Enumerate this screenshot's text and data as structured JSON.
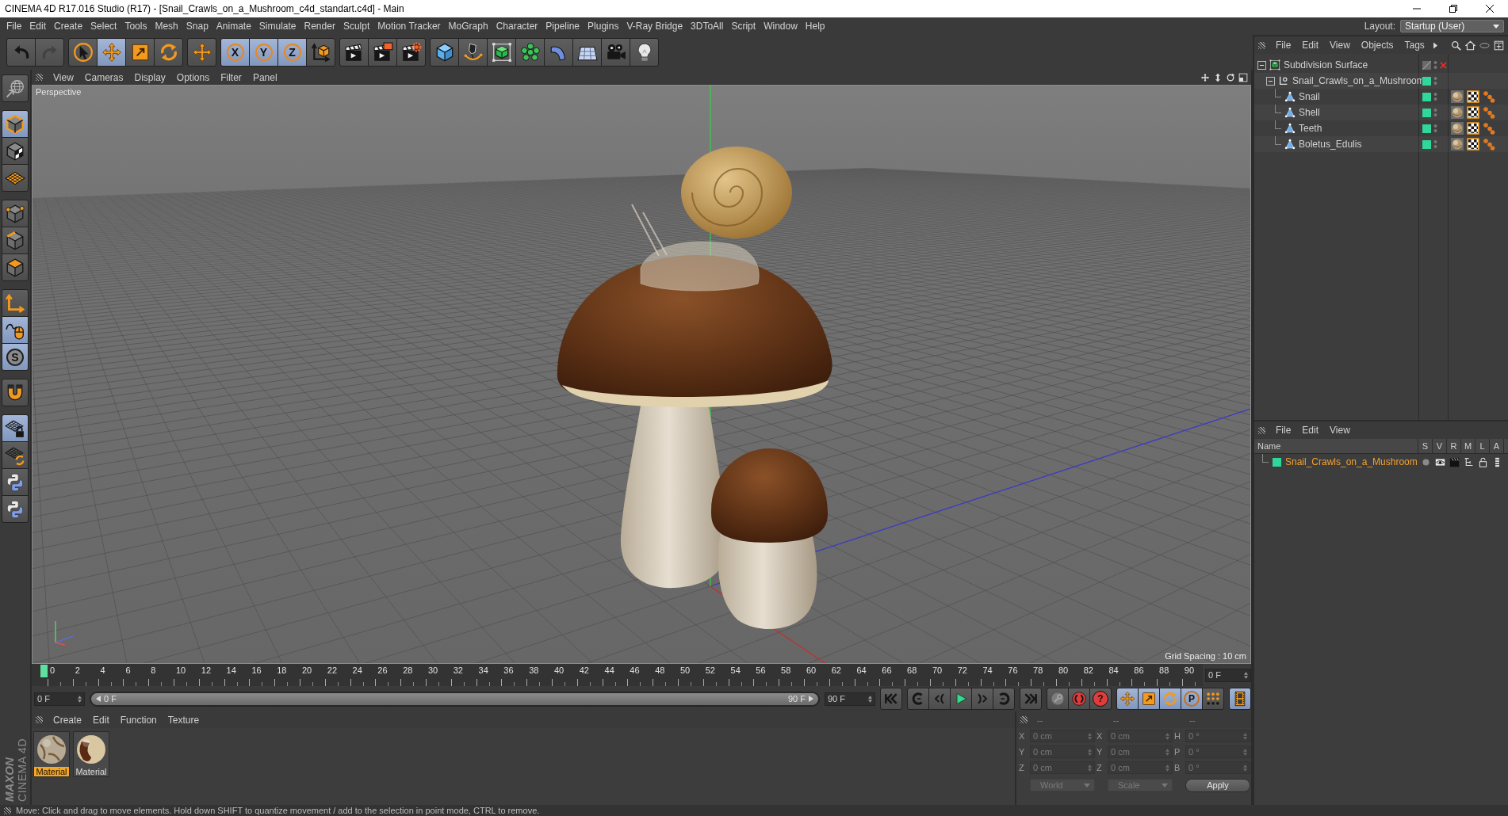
{
  "window": {
    "title": "CINEMA 4D R17.016 Studio (R17) - [Snail_Crawls_on_a_Mushroom_c4d_standart.c4d] - Main"
  },
  "menu_bar": [
    "File",
    "Edit",
    "Create",
    "Select",
    "Tools",
    "Mesh",
    "Snap",
    "Animate",
    "Simulate",
    "Render",
    "Sculpt",
    "Motion Tracker",
    "MoGraph",
    "Character",
    "Pipeline",
    "Plugins",
    "V-Ray Bridge",
    "3DToAll",
    "Script",
    "Window",
    "Help"
  ],
  "layout": {
    "label": "Layout:",
    "value": "Startup (User)"
  },
  "toolbar": [
    [
      {
        "kind": "undo",
        "selected": false,
        "disabled": false
      },
      {
        "kind": "redo",
        "selected": false,
        "disabled": true
      }
    ],
    [
      {
        "kind": "live-selection",
        "selected": false,
        "disabled": false
      },
      {
        "kind": "move",
        "selected": true,
        "disabled": false
      },
      {
        "kind": "scale",
        "selected": false,
        "disabled": false
      },
      {
        "kind": "rotate",
        "selected": false,
        "disabled": false
      }
    ],
    [
      {
        "kind": "recent-tool",
        "selected": false,
        "disabled": false
      }
    ],
    [
      {
        "kind": "x-axis",
        "label": "X",
        "selected": true,
        "disabled": false
      },
      {
        "kind": "y-axis",
        "label": "Y",
        "selected": true,
        "disabled": false
      },
      {
        "kind": "z-axis",
        "label": "Z",
        "selected": true,
        "disabled": false
      },
      {
        "kind": "coordinate-system",
        "selected": false,
        "disabled": false
      }
    ],
    [
      {
        "kind": "render-view",
        "selected": false,
        "disabled": false
      },
      {
        "kind": "render-picture-viewer",
        "selected": false,
        "disabled": false
      },
      {
        "kind": "render-settings",
        "selected": false,
        "disabled": false
      }
    ],
    [
      {
        "kind": "cube",
        "selected": false,
        "disabled": false
      },
      {
        "kind": "pen",
        "selected": false,
        "disabled": false
      },
      {
        "kind": "subdivision",
        "selected": false,
        "disabled": false
      },
      {
        "kind": "cloner",
        "selected": false,
        "disabled": false
      },
      {
        "kind": "bend",
        "selected": false,
        "disabled": false
      },
      {
        "kind": "floor",
        "selected": false,
        "disabled": false
      },
      {
        "kind": "camera",
        "selected": false,
        "disabled": false
      },
      {
        "kind": "light",
        "selected": false,
        "disabled": false
      }
    ]
  ],
  "tools": [
    [
      {
        "kind": "make-editable",
        "selected": false
      }
    ],
    [
      {
        "kind": "model",
        "selected": true
      },
      {
        "kind": "texture",
        "selected": false
      },
      {
        "kind": "workplane",
        "selected": false
      }
    ],
    [
      {
        "kind": "points",
        "selected": false
      },
      {
        "kind": "edges",
        "selected": false
      },
      {
        "kind": "polygons",
        "selected": false
      }
    ],
    [
      {
        "kind": "axis",
        "selected": false
      },
      {
        "kind": "tweak",
        "selected": true
      },
      {
        "kind": "solo",
        "label": "S",
        "selected": true
      }
    ],
    [
      {
        "kind": "snap",
        "selected": false
      }
    ],
    [
      {
        "kind": "workplane-lock",
        "selected": true
      },
      {
        "kind": "workplane-align",
        "selected": false
      },
      {
        "kind": "python",
        "selected": false
      },
      {
        "kind": "python",
        "selected": false
      }
    ]
  ],
  "viewport": {
    "menu": [
      "View",
      "Cameras",
      "Display",
      "Options",
      "Filter",
      "Panel"
    ],
    "camera": "Perspective",
    "grid_spacing": "Grid Spacing : 10 cm"
  },
  "timeline": {
    "ticks": [
      "0",
      "2",
      "4",
      "6",
      "8",
      "10",
      "12",
      "14",
      "16",
      "18",
      "20",
      "22",
      "24",
      "26",
      "28",
      "30",
      "32",
      "34",
      "36",
      "38",
      "40",
      "42",
      "44",
      "46",
      "48",
      "50",
      "52",
      "54",
      "56",
      "58",
      "60",
      "62",
      "64",
      "66",
      "68",
      "70",
      "72",
      "74",
      "76",
      "78",
      "80",
      "82",
      "84",
      "86",
      "88",
      "90"
    ],
    "playhead": {
      "level": 0
    },
    "current_frame": "0 F",
    "start_field": "0 F",
    "range": {
      "start": "0 F",
      "end": "90 F",
      "level": 1
    },
    "end_field": "90 F"
  },
  "transport": [
    [
      {
        "kind": "go-start",
        "selected": false
      }
    ],
    [
      {
        "kind": "prev-key",
        "selected": false
      },
      {
        "kind": "prev-frame",
        "selected": false
      },
      {
        "kind": "play",
        "selected": false
      },
      {
        "kind": "next-frame",
        "selected": false
      },
      {
        "kind": "next-key",
        "selected": false
      }
    ],
    [
      {
        "kind": "go-end",
        "selected": false
      }
    ],
    [
      {
        "kind": "autokey",
        "selected": false
      },
      {
        "kind": "record",
        "selected": false
      },
      {
        "kind": "key-selection",
        "label": "?",
        "selected": false
      }
    ],
    [
      {
        "kind": "move",
        "selected": true
      },
      {
        "kind": "scale",
        "selected": true
      },
      {
        "kind": "rotate",
        "selected": true
      },
      {
        "kind": "param",
        "label": "P",
        "selected": true
      },
      {
        "kind": "point-level",
        "selected": false
      }
    ],
    [
      {
        "kind": "timeline-window",
        "selected": true
      }
    ]
  ],
  "material_manager": {
    "menu": [
      "Create",
      "Edit",
      "Function",
      "Texture"
    ],
    "materials": [
      {
        "name": "Material",
        "selected": true
      },
      {
        "name": "Material",
        "selected": false
      }
    ]
  },
  "coordinates": {
    "headers": [
      "--",
      "--",
      "--"
    ],
    "rows": [
      {
        "labels": [
          "X",
          "X",
          "H"
        ],
        "values": [
          "0 cm",
          "0 cm",
          "0 °"
        ]
      },
      {
        "labels": [
          "Y",
          "Y",
          "P"
        ],
        "values": [
          "0 cm",
          "0 cm",
          "0 °"
        ]
      },
      {
        "labels": [
          "Z",
          "Z",
          "B"
        ],
        "values": [
          "0 cm",
          "0 cm",
          "0 °"
        ]
      }
    ],
    "dropdowns": [
      "World",
      "Scale"
    ],
    "apply": "Apply"
  },
  "object_manager": {
    "menu": [
      "File",
      "Edit",
      "View",
      "Objects",
      "Tags"
    ],
    "tree": [
      {
        "name": "Subdivision Surface",
        "kind": "subdivision",
        "expanded": true,
        "enabled": false,
        "children": [
          {
            "name": "Snail_Crawls_on_a_Mushroom",
            "kind": "null",
            "expanded": true,
            "color": "#2fd79b",
            "children": [
              {
                "name": "Snail",
                "kind": "polygon",
                "color": "#2fd79b",
                "tags": [
                  {
                    "kind": "material"
                  },
                  {
                    "kind": "uvw"
                  },
                  {
                    "kind": "phong"
                  }
                ]
              },
              {
                "name": "Shell",
                "kind": "polygon",
                "color": "#2fd79b",
                "tags": [
                  {
                    "kind": "material"
                  },
                  {
                    "kind": "uvw"
                  },
                  {
                    "kind": "phong"
                  }
                ]
              },
              {
                "name": "Teeth",
                "kind": "polygon",
                "color": "#2fd79b",
                "tags": [
                  {
                    "kind": "material"
                  },
                  {
                    "kind": "uvw"
                  },
                  {
                    "kind": "phong"
                  }
                ]
              },
              {
                "name": "Boletus_Edulis",
                "kind": "polygon",
                "color": "#2fd79b",
                "tags": [
                  {
                    "kind": "material"
                  },
                  {
                    "kind": "uvw"
                  },
                  {
                    "kind": "phong"
                  }
                ]
              }
            ]
          }
        ]
      }
    ]
  },
  "layer_manager": {
    "menu": [
      "File",
      "Edit",
      "View"
    ],
    "columns": [
      "Name",
      "S",
      "V",
      "R",
      "M",
      "L",
      "A"
    ],
    "layers": [
      {
        "name": "Snail_Crawls_on_a_Mushroom",
        "color": "#2fd79b"
      }
    ]
  },
  "logo": {
    "brand": "MAXON",
    "product": "CINEMA 4D"
  },
  "status_bar": "Move: Click and drag to move elements. Hold down SHIFT to quantize movement / add to the selection in point mode, CTRL to remove."
}
